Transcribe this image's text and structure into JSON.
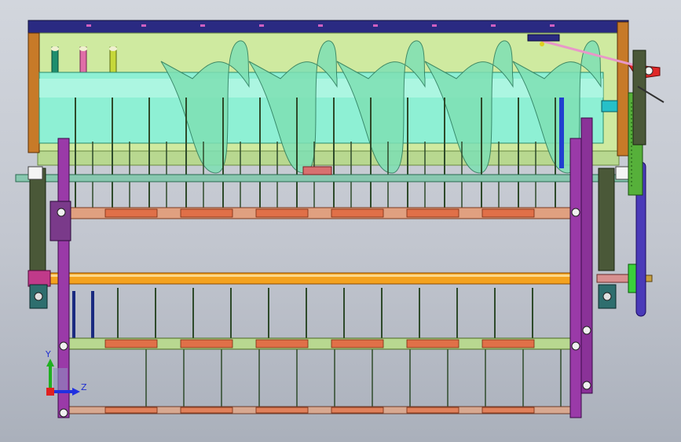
{
  "view": {
    "background_top": "#d2d6dd",
    "background_bottom": "#aab0bb"
  },
  "colors": {
    "frame_top_bar": "#2a2a82",
    "side_plate": "#c77a28",
    "drum_shell": "#cfeaa0",
    "auger_core": "#8ef0d4",
    "auger_flight": "#7ee0b4",
    "main_shaft": "#f4a21e",
    "shaft_bar": "#88c8b0",
    "tine_bar": "#e07048",
    "rail": "#b8d890",
    "purple_parts": "#9a3aa8",
    "side_supports": "#4a5838",
    "drive_wheel": "#4a3ab8",
    "red_lever": "#e02828",
    "green_gear": "#56b03a"
  },
  "triad": {
    "y_label": "Y",
    "z_label": "Z",
    "y_icon": "axis-y-arrow-icon",
    "z_icon": "axis-z-arrow-icon"
  },
  "counts": {
    "auger_turns": 5
  }
}
